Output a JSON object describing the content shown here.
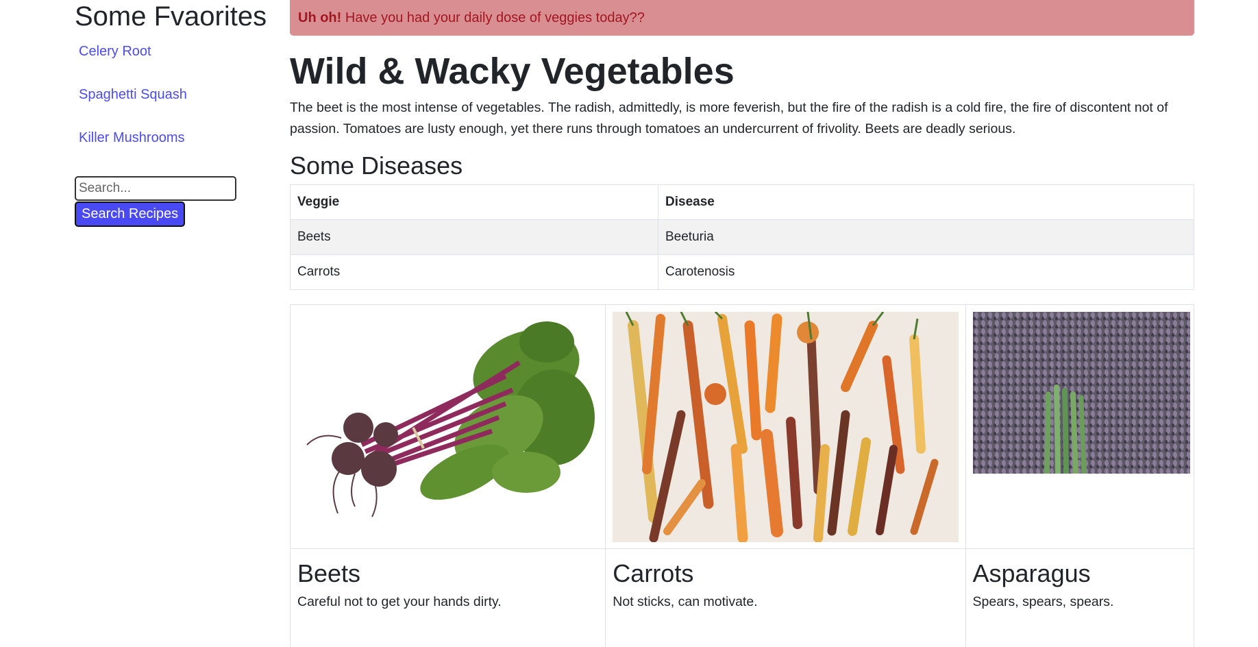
{
  "sidebar": {
    "title": "Some Fvaorites",
    "favorites": [
      "Celery Root",
      "Spaghetti Squash",
      "Killer Mushrooms"
    ],
    "search_placeholder": "Search...",
    "search_button": "Search Recipes"
  },
  "alert": {
    "strong": "Uh oh!",
    "text": " Have you had your daily dose of veggies today??"
  },
  "main": {
    "title": "Wild & Wacky Vegetables",
    "intro": "The beet is the most intense of vegetables. The radish, admittedly, is more feverish, but the fire of the radish is a cold fire, the fire of discontent not of passion. Tomatoes are lusty enough, yet there runs through tomatoes an undercurrent of frivolity. Beets are deadly serious.",
    "diseases_heading": "Some Diseases"
  },
  "table": {
    "headers": [
      "Veggie",
      "Disease"
    ],
    "rows": [
      [
        "Beets",
        "Beeturia"
      ],
      [
        "Carrots",
        "Carotenosis"
      ]
    ]
  },
  "cards": [
    {
      "title": "Beets",
      "text": "Careful not to get your hands dirty.",
      "image": "beets-photo"
    },
    {
      "title": "Carrots",
      "text": "Not sticks, can motivate.",
      "image": "carrots-photo"
    },
    {
      "title": "Asparagus",
      "text": "Spears, spears, spears.",
      "image": "asparagus-photo"
    }
  ],
  "colors": {
    "link": "#4b4bf0",
    "button": "#4a4af4",
    "alert_bg": "#d98f92",
    "alert_text": "#a11622"
  }
}
